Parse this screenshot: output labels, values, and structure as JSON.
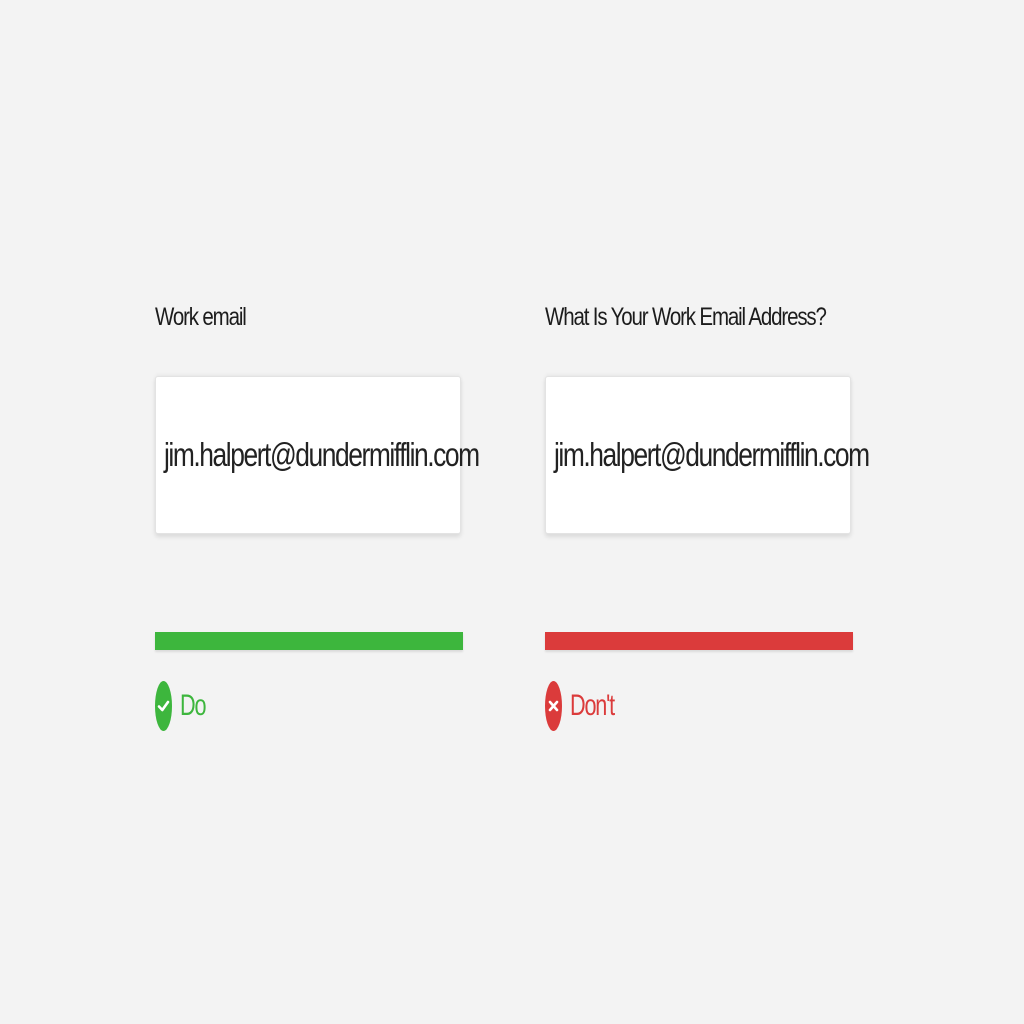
{
  "examples": [
    {
      "label": "Work email",
      "value": "jim.halpert@dundermifflin.com",
      "verdict": "Do",
      "verdict_color": "#3db63d",
      "verdict_icon": "check-circle-icon"
    },
    {
      "label": "What Is Your Work Email Address?",
      "value": "jim.halpert@dundermifflin.com",
      "verdict": "Don't",
      "verdict_color": "#db3b3b",
      "verdict_icon": "x-circle-icon"
    }
  ],
  "colors": {
    "background": "#f3f3f3",
    "do": "#3db63d",
    "dont": "#db3b3b"
  }
}
